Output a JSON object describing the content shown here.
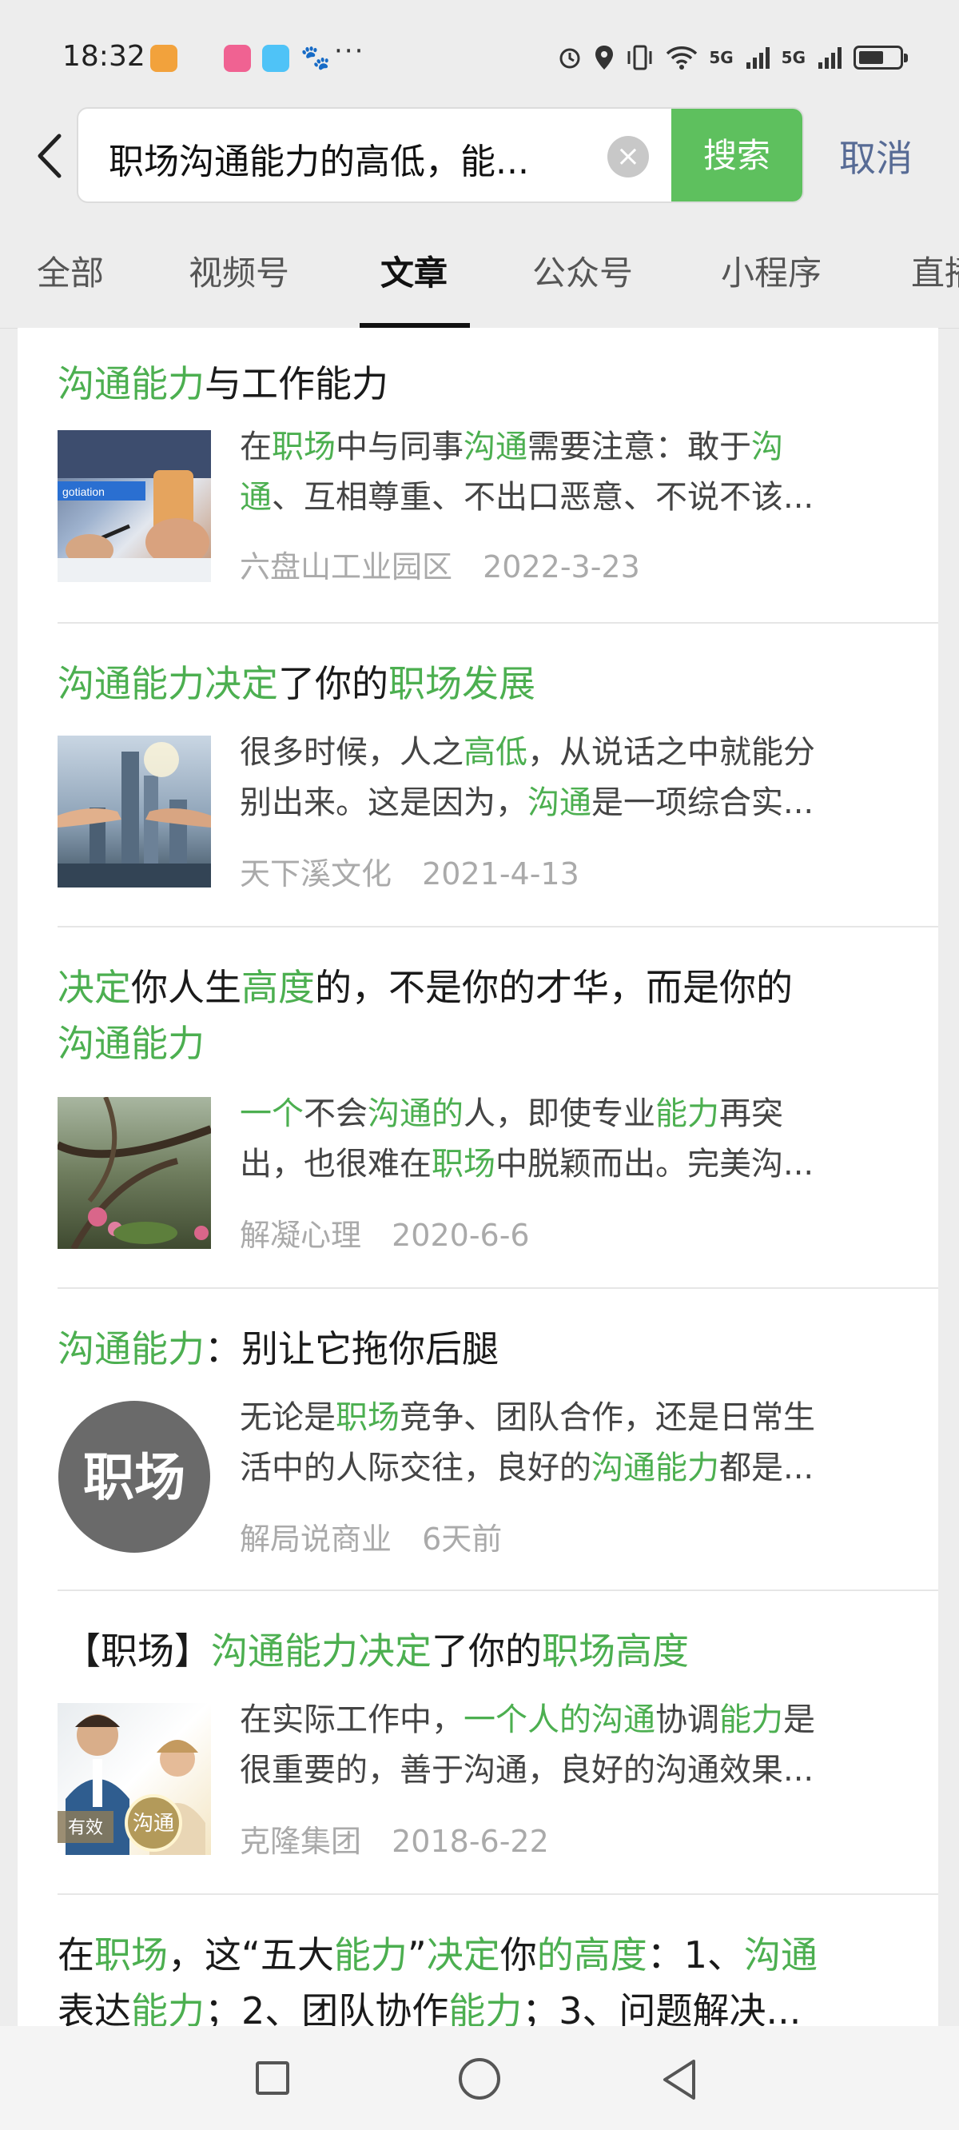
{
  "status_bar": {
    "time": "18:32",
    "network": "5G",
    "network2": "5G"
  },
  "search": {
    "query": "职场沟通能力的高低，能...",
    "clear_label": "×",
    "button": "搜索",
    "cancel": "取消"
  },
  "tabs": [
    "全部",
    "视频号",
    "文章",
    "公众号",
    "小程序",
    "直播"
  ],
  "colors": {
    "accent": "#4caf50",
    "button": "#5ec05e",
    "link": "#576b95"
  },
  "articles": [
    {
      "title": [
        [
          "沟通能力",
          true
        ],
        [
          "与工作能力",
          false
        ]
      ],
      "summary1": [
        [
          "在",
          false
        ],
        [
          "职场",
          true
        ],
        [
          "中与同事",
          false
        ],
        [
          "沟通",
          true
        ],
        [
          "需要注意：敢于",
          false
        ],
        [
          "沟",
          true
        ]
      ],
      "summary2": [
        [
          "通",
          true
        ],
        [
          "、互相尊重、不出口恶意、不说不该...",
          false
        ]
      ],
      "source": "六盘山工业园区",
      "date": "2022-3-23",
      "thumb_text": "gotiation"
    },
    {
      "title": [
        [
          "沟通能力决定",
          true
        ],
        [
          "了你的",
          false
        ],
        [
          "职场发展",
          true
        ]
      ],
      "summary1": [
        [
          "很多时候，人之",
          false
        ],
        [
          "高低",
          true
        ],
        [
          "，从说话之中就能分",
          false
        ]
      ],
      "summary2": [
        [
          "别出来。这是因为，",
          false
        ],
        [
          "沟通",
          true
        ],
        [
          "是一项综合实...",
          false
        ]
      ],
      "source": "天下溪文化",
      "date": "2021-4-13"
    },
    {
      "title": [
        [
          "决定",
          true
        ],
        [
          "你人生",
          false
        ],
        [
          "高度",
          true
        ],
        [
          "的，不是你的才华，而是你的",
          false
        ]
      ],
      "title2": [
        [
          "沟通能力",
          true
        ]
      ],
      "summary1": [
        [
          "一个",
          true
        ],
        [
          "不会",
          false
        ],
        [
          "沟通的",
          true
        ],
        [
          "人，即使专业",
          false
        ],
        [
          "能力",
          true
        ],
        [
          "再突",
          false
        ]
      ],
      "summary2": [
        [
          "出，也很难在",
          false
        ],
        [
          "职场",
          true
        ],
        [
          "中脱颖而出。完美沟...",
          false
        ]
      ],
      "source": "解凝心理",
      "date": "2020-6-6"
    },
    {
      "title": [
        [
          "沟通能力",
          true
        ],
        [
          "：别让它拖你后腿",
          false
        ]
      ],
      "summary1": [
        [
          "无论是",
          false
        ],
        [
          "职场",
          true
        ],
        [
          "竞争、团队合作，还是日常生",
          false
        ]
      ],
      "summary2": [
        [
          "活中的人际交往，良好的",
          false
        ],
        [
          "沟通能力",
          true
        ],
        [
          "都是...",
          false
        ]
      ],
      "source": "解局说商业",
      "date": "6天前",
      "thumb_text": "职场"
    },
    {
      "title": [
        [
          "【职场】",
          false
        ],
        [
          "沟通能力决定",
          true
        ],
        [
          "了你的",
          false
        ],
        [
          "职场高度",
          true
        ]
      ],
      "summary1": [
        [
          "在实际工作中，",
          false
        ],
        [
          "一个人的沟通",
          true
        ],
        [
          "协调",
          false
        ],
        [
          "能力",
          true
        ],
        [
          "是",
          false
        ]
      ],
      "summary2": [
        [
          "很重要的，善于沟通，良好的沟通效果...",
          false
        ]
      ],
      "source": "克隆集团",
      "date": "2018-6-22",
      "thumb_text": "有效",
      "thumb_text2": "沟通"
    },
    {
      "title": [
        [
          "在",
          false
        ],
        [
          "职场",
          true
        ],
        [
          "，这“五大",
          false
        ],
        [
          "能力",
          true
        ],
        [
          "”",
          false
        ],
        [
          "决定",
          true
        ],
        [
          "你",
          false
        ],
        [
          "的高度",
          true
        ],
        [
          "：1、",
          false
        ],
        [
          "沟通",
          true
        ]
      ],
      "title2": [
        [
          "表达",
          false
        ],
        [
          "能力",
          true
        ],
        [
          "；2、团队协作",
          false
        ],
        [
          "能力",
          true
        ],
        [
          "；3、问题解决...",
          false
        ]
      ]
    }
  ]
}
